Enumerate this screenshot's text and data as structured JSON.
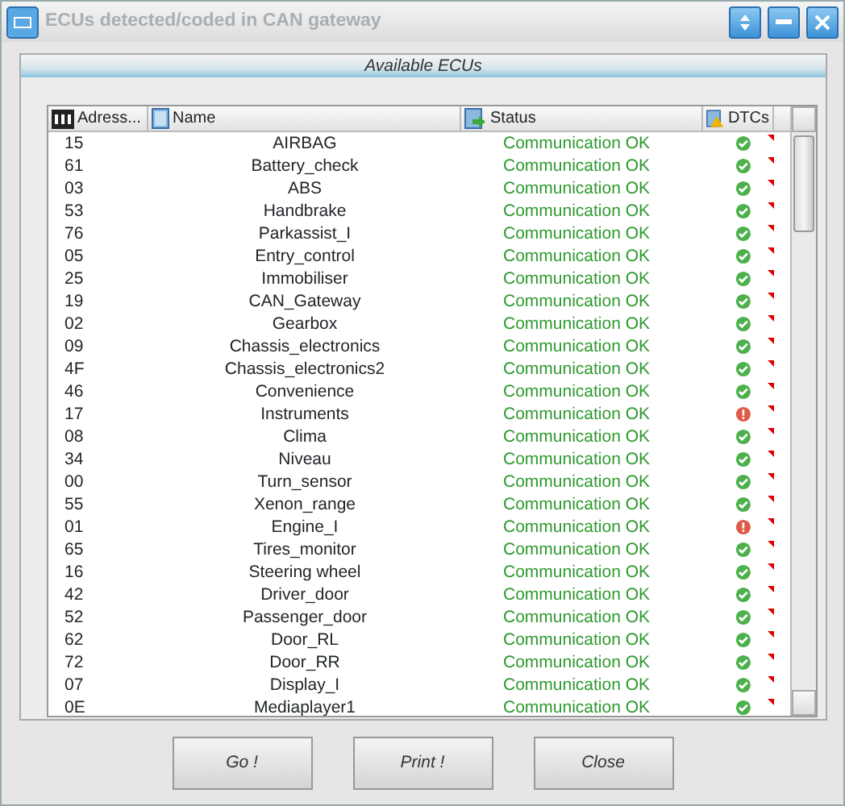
{
  "window": {
    "title": "ECUs detected/coded in CAN gateway"
  },
  "panel": {
    "title": "Available ECUs"
  },
  "table": {
    "columns": [
      "Adress...",
      "Name",
      "Status",
      "DTCs"
    ],
    "rows": [
      {
        "address": "15",
        "name": "AIRBAG",
        "status": "Communication OK",
        "dtc_error": false
      },
      {
        "address": "61",
        "name": "Battery_check",
        "status": "Communication OK",
        "dtc_error": false
      },
      {
        "address": "03",
        "name": "ABS",
        "status": "Communication OK",
        "dtc_error": false
      },
      {
        "address": "53",
        "name": "Handbrake",
        "status": "Communication OK",
        "dtc_error": false
      },
      {
        "address": "76",
        "name": "Parkassist_I",
        "status": "Communication OK",
        "dtc_error": false
      },
      {
        "address": "05",
        "name": "Entry_control",
        "status": "Communication OK",
        "dtc_error": false
      },
      {
        "address": "25",
        "name": "Immobiliser",
        "status": "Communication OK",
        "dtc_error": false
      },
      {
        "address": "19",
        "name": "CAN_Gateway",
        "status": "Communication OK",
        "dtc_error": false
      },
      {
        "address": "02",
        "name": "Gearbox",
        "status": "Communication OK",
        "dtc_error": false
      },
      {
        "address": "09",
        "name": "Chassis_electronics",
        "status": "Communication OK",
        "dtc_error": false
      },
      {
        "address": "4F",
        "name": "Chassis_electronics2",
        "status": "Communication OK",
        "dtc_error": false
      },
      {
        "address": "46",
        "name": "Convenience",
        "status": "Communication OK",
        "dtc_error": false
      },
      {
        "address": "17",
        "name": "Instruments",
        "status": "Communication OK",
        "dtc_error": true
      },
      {
        "address": "08",
        "name": "Clima",
        "status": "Communication OK",
        "dtc_error": false
      },
      {
        "address": "34",
        "name": "Niveau",
        "status": "Communication OK",
        "dtc_error": false
      },
      {
        "address": "00",
        "name": "Turn_sensor",
        "status": "Communication OK",
        "dtc_error": false
      },
      {
        "address": "55",
        "name": "Xenon_range",
        "status": "Communication OK",
        "dtc_error": false
      },
      {
        "address": "01",
        "name": "Engine_I",
        "status": "Communication OK",
        "dtc_error": true
      },
      {
        "address": "65",
        "name": "Tires_monitor",
        "status": "Communication OK",
        "dtc_error": false
      },
      {
        "address": "16",
        "name": "Steering wheel",
        "status": "Communication OK",
        "dtc_error": false
      },
      {
        "address": "42",
        "name": "Driver_door",
        "status": "Communication OK",
        "dtc_error": false
      },
      {
        "address": "52",
        "name": "Passenger_door",
        "status": "Communication OK",
        "dtc_error": false
      },
      {
        "address": "62",
        "name": "Door_RL",
        "status": "Communication OK",
        "dtc_error": false
      },
      {
        "address": "72",
        "name": "Door_RR",
        "status": "Communication OK",
        "dtc_error": false
      },
      {
        "address": "07",
        "name": "Display_I",
        "status": "Communication OK",
        "dtc_error": false
      },
      {
        "address": "0E",
        "name": "Mediaplayer1",
        "status": "Communication OK",
        "dtc_error": false
      }
    ]
  },
  "buttons": [
    "Go !",
    "Print !",
    "Close"
  ]
}
